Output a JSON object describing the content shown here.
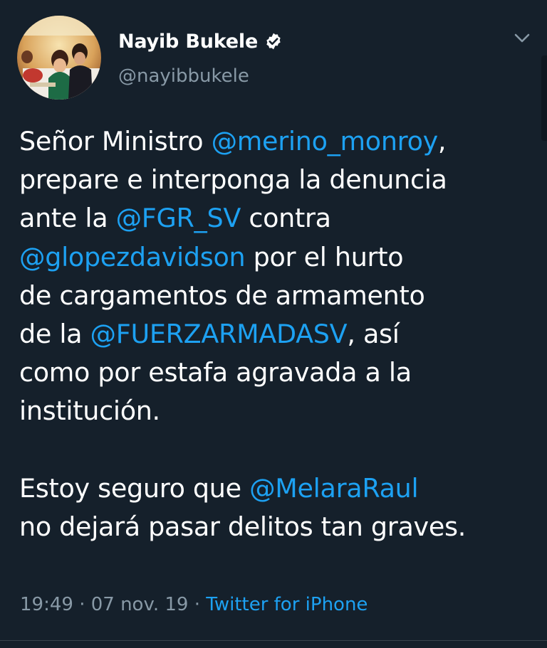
{
  "author": {
    "display_name": "Nayib Bukele",
    "handle": "@nayibbukele",
    "verified_icon": "verified-badge-icon",
    "avatar_icon": "profile-photo"
  },
  "menu": {
    "icon": "chevron-down-icon"
  },
  "tweet": {
    "lines": [
      [
        {
          "t": "Señor Ministro ",
          "m": false
        },
        {
          "t": "@merino_monroy",
          "m": true
        },
        {
          "t": ",",
          "m": false
        }
      ],
      [
        {
          "t": "prepare e interponga la denuncia",
          "m": false
        }
      ],
      [
        {
          "t": "ante la ",
          "m": false
        },
        {
          "t": "@FGR_SV",
          "m": true
        },
        {
          "t": " contra",
          "m": false
        }
      ],
      [
        {
          "t": "@glopezdavidson",
          "m": true
        },
        {
          "t": " por el hurto",
          "m": false
        }
      ],
      [
        {
          "t": "de cargamentos de armamento",
          "m": false
        }
      ],
      [
        {
          "t": "de la ",
          "m": false
        },
        {
          "t": "@FUERZARMADASV",
          "m": true
        },
        {
          "t": ", así",
          "m": false
        }
      ],
      [
        {
          "t": "como por estafa agravada a la",
          "m": false
        }
      ],
      [
        {
          "t": "institución.",
          "m": false
        }
      ],
      [],
      [
        {
          "t": "Estoy seguro que ",
          "m": false
        },
        {
          "t": "@MelaraRaul",
          "m": true
        }
      ],
      [
        {
          "t": "no dejará pasar delitos tan graves.",
          "m": false
        }
      ]
    ]
  },
  "meta": {
    "time": "19:49",
    "sep1": " · ",
    "date": "07 nov. 19",
    "sep2": " · ",
    "source": "Twitter for iPhone"
  },
  "colors": {
    "background": "#15202b",
    "mention": "#1da1f2",
    "secondary_text": "#8899a6"
  }
}
